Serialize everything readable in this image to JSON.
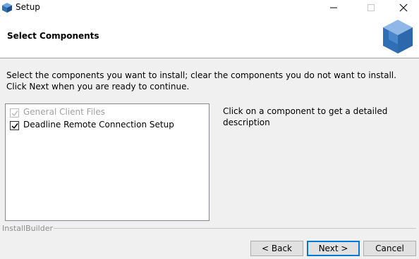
{
  "window": {
    "title": "Setup"
  },
  "header": {
    "title": "Select Components"
  },
  "intro_text": "Select the components you want to install; clear the components you do not want to install. Click Next when you are ready to continue.",
  "components": [
    {
      "label": "General Client Files",
      "checked": true,
      "enabled": false
    },
    {
      "label": "Deadline Remote Connection Setup",
      "checked": true,
      "enabled": true
    }
  ],
  "description_text": "Click on a component to get a detailed description",
  "footer": {
    "brand": "InstallBuilder"
  },
  "buttons": {
    "back": "< Back",
    "next": "Next >",
    "cancel": "Cancel"
  },
  "colors": {
    "accent": "#0078d7",
    "logo_blue": "#2f6fb5"
  },
  "icons": {
    "app": "cube-icon",
    "minimize": "minimize-icon",
    "maximize": "maximize-icon",
    "close": "close-icon"
  }
}
